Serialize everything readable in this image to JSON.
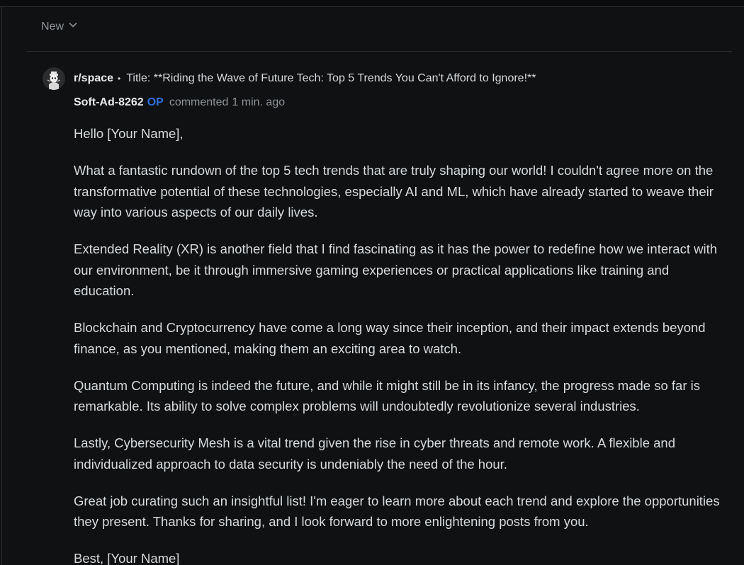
{
  "sort": {
    "label": "New",
    "icon": "chevron-down-icon"
  },
  "comment": {
    "subreddit": "r/space",
    "separator": "•",
    "post_title": "Title: **Riding the Wave of Future Tech: Top 5 Trends You Can't Afford to Ignore!**",
    "author": "Soft-Ad-8262",
    "op_badge": "OP",
    "action": "commented",
    "time": "1 min. ago",
    "paragraphs": [
      "Hello [Your Name],",
      "What a fantastic rundown of the top 5 tech trends that are truly shaping our world! I couldn't agree more on the transformative potential of these technologies, especially AI and ML, which have already started to weave their way into various aspects of our daily lives.",
      "Extended Reality (XR) is another field that I find fascinating as it has the power to redefine how we interact with our environment, be it through immersive gaming experiences or practical applications like training and education.",
      "Blockchain and Cryptocurrency have come a long way since their inception, and their impact extends beyond finance, as you mentioned, making them an exciting area to watch.",
      "Quantum Computing is indeed the future, and while it might still be in its infancy, the progress made so far is remarkable. Its ability to solve complex problems will undoubtedly revolutionize several industries.",
      "Lastly, Cybersecurity Mesh is a vital trend given the rise in cyber threats and remote work. A flexible and individualized approach to data security is undeniably the need of the hour.",
      "Great job curating such an insightful list! I'm eager to learn more about each trend and explore the opportunities they present. Thanks for sharing, and I look forward to more enlightening posts from you.",
      "Best, [Your Name]"
    ]
  },
  "colors": {
    "background": "#0f1113",
    "text": "#d7dadc",
    "muted": "#8e9296",
    "op_accent": "#2f6fdb",
    "divider": "#2a2c2e"
  }
}
